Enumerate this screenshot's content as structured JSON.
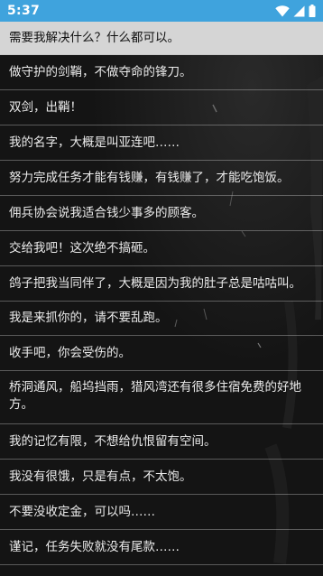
{
  "status_bar": {
    "time": "5:37",
    "background_color": "#3fa3dd",
    "icons": [
      "wifi-icon",
      "cellular-signal-icon",
      "battery-icon"
    ]
  },
  "dialogue_options": [
    {
      "text": "需要我解决什么？什么都可以。",
      "selected": true
    },
    {
      "text": "做守护的剑鞘，不做夺命的锋刀。",
      "selected": false
    },
    {
      "text": "双剑，出鞘！",
      "selected": false
    },
    {
      "text": "我的名字，大概是叫亚连吧……",
      "selected": false
    },
    {
      "text": "努力完成任务才能有钱赚，有钱赚了，才能吃饱饭。",
      "selected": false
    },
    {
      "text": "佣兵协会说我适合钱少事多的顾客。",
      "selected": false
    },
    {
      "text": "交给我吧！这次绝不搞砸。",
      "selected": false
    },
    {
      "text": "鸽子把我当同伴了，大概是因为我的肚子总是咕咕叫。",
      "selected": false
    },
    {
      "text": "我是来抓你的，请不要乱跑。",
      "selected": false
    },
    {
      "text": "收手吧，你会受伤的。",
      "selected": false
    },
    {
      "text": "桥洞通风，船坞挡雨，猎风湾还有很多住宿免费的好地方。",
      "selected": false
    },
    {
      "text": "我的记忆有限，不想给仇恨留有空间。",
      "selected": false
    },
    {
      "text": "我没有很饿，只是有点，不太饱。",
      "selected": false
    },
    {
      "text": "不要没收定金，可以吗……",
      "selected": false
    },
    {
      "text": "谨记，任务失败就没有尾款……",
      "selected": false
    }
  ]
}
